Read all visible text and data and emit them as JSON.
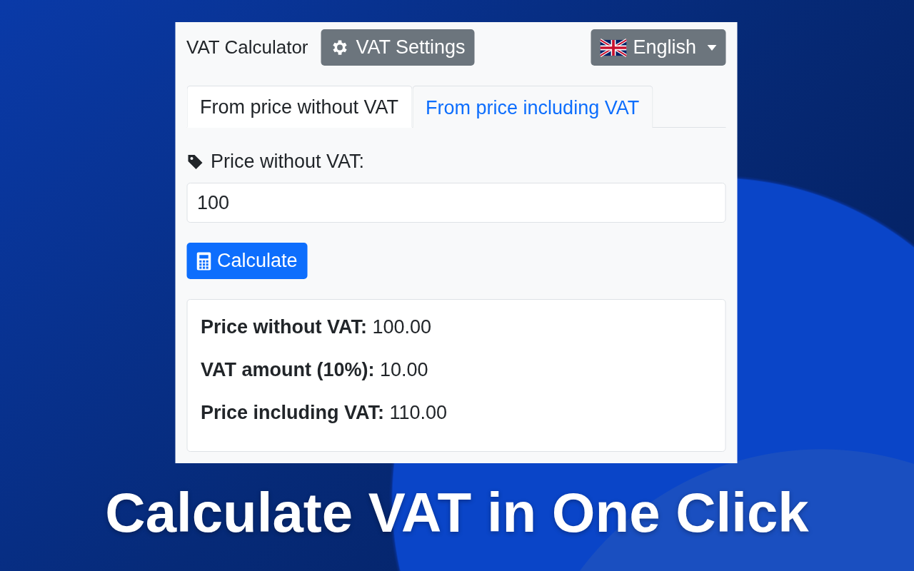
{
  "header": {
    "title": "VAT Calculator",
    "settings_button": "VAT Settings",
    "language_button": "English"
  },
  "tabs": [
    {
      "label": "From price without VAT",
      "selected": true
    },
    {
      "label": "From price including VAT",
      "selected": false
    }
  ],
  "field": {
    "label": "Price without VAT:",
    "value": "100"
  },
  "calculate_button": "Calculate",
  "results": [
    "**Price without VAT:** 100.00",
    "**VAT amount (10%):** 10.00",
    "**Price including VAT:** 110.00"
  ],
  "headline": "Calculate VAT in One Click"
}
